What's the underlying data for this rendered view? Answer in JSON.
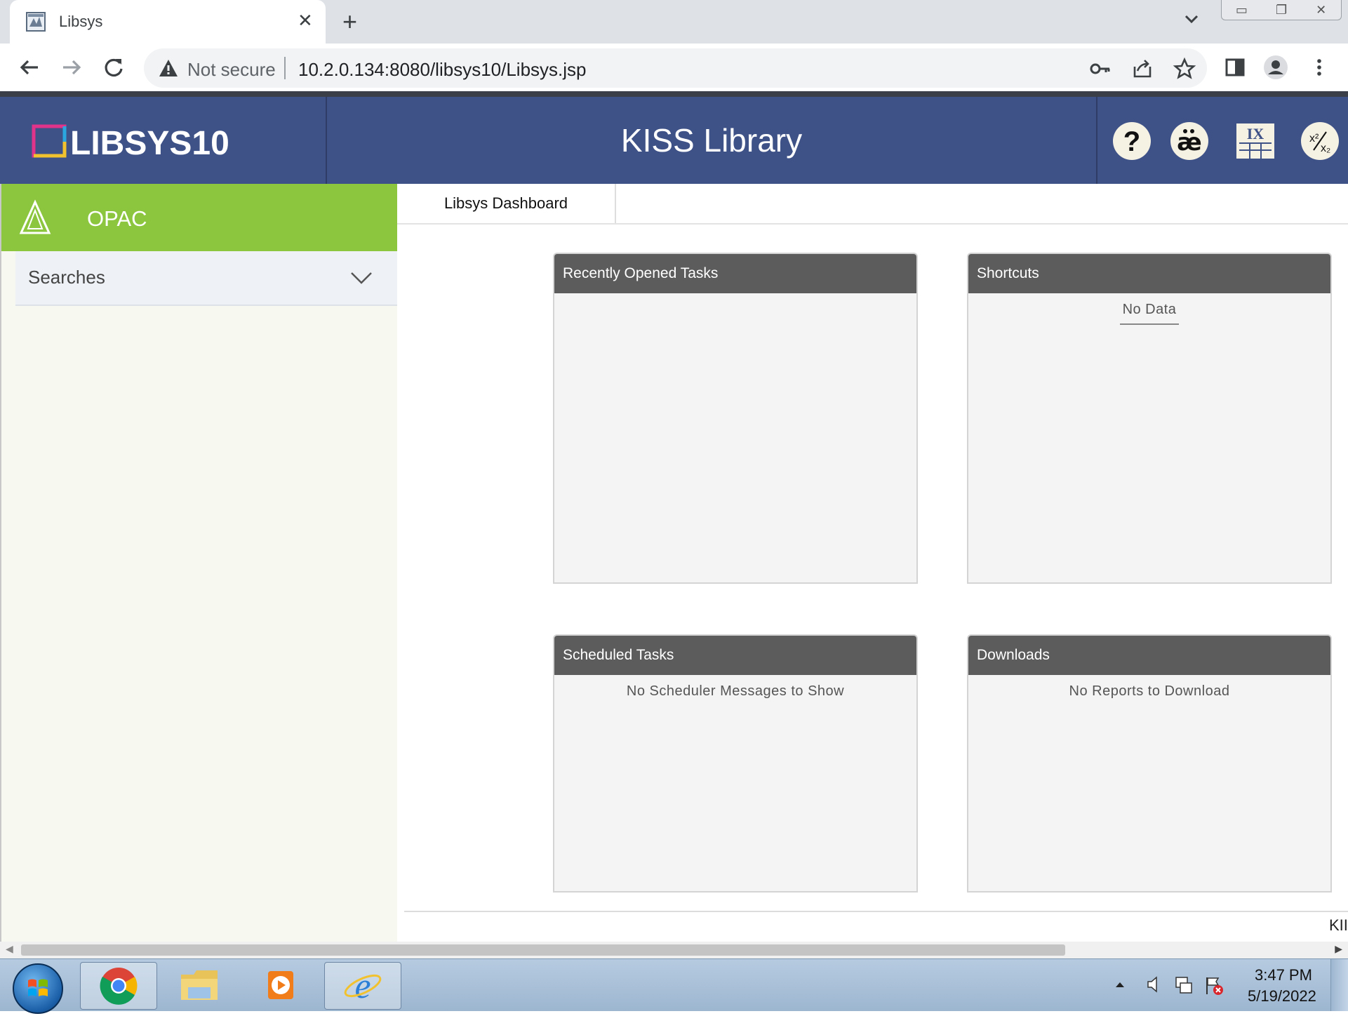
{
  "browser": {
    "tab_title": "Libsys",
    "security_label": "Not secure",
    "url": "10.2.0.134:8080/libsys10/Libsys.jsp"
  },
  "app": {
    "logo_text": "LIBSYS10",
    "title": "KISS Library",
    "header_icons": [
      "help-icon",
      "special-characters-icon",
      "roman-numerals-icon",
      "superscript-subscript-icon"
    ]
  },
  "sidebar": {
    "module": "OPAC",
    "sections": [
      {
        "label": "Searches"
      }
    ]
  },
  "main": {
    "tabs": [
      {
        "label": "Libsys Dashboard"
      }
    ],
    "panels": [
      {
        "title": "Recently Opened Tasks",
        "message": ""
      },
      {
        "title": "Shortcuts",
        "message": "No Data"
      },
      {
        "title": "Scheduled Tasks",
        "message": "No Scheduler Messages to Show"
      },
      {
        "title": "Downloads",
        "message": "No Reports to Download"
      }
    ],
    "footer_text": "KII"
  },
  "taskbar": {
    "time": "3:47 PM",
    "date": "5/19/2022",
    "apps": [
      "chrome",
      "file-explorer",
      "media-player",
      "internet-explorer"
    ]
  },
  "colors": {
    "header": "#3f5287",
    "opac": "#8cc63f",
    "panel_header": "#5c5c5c"
  }
}
